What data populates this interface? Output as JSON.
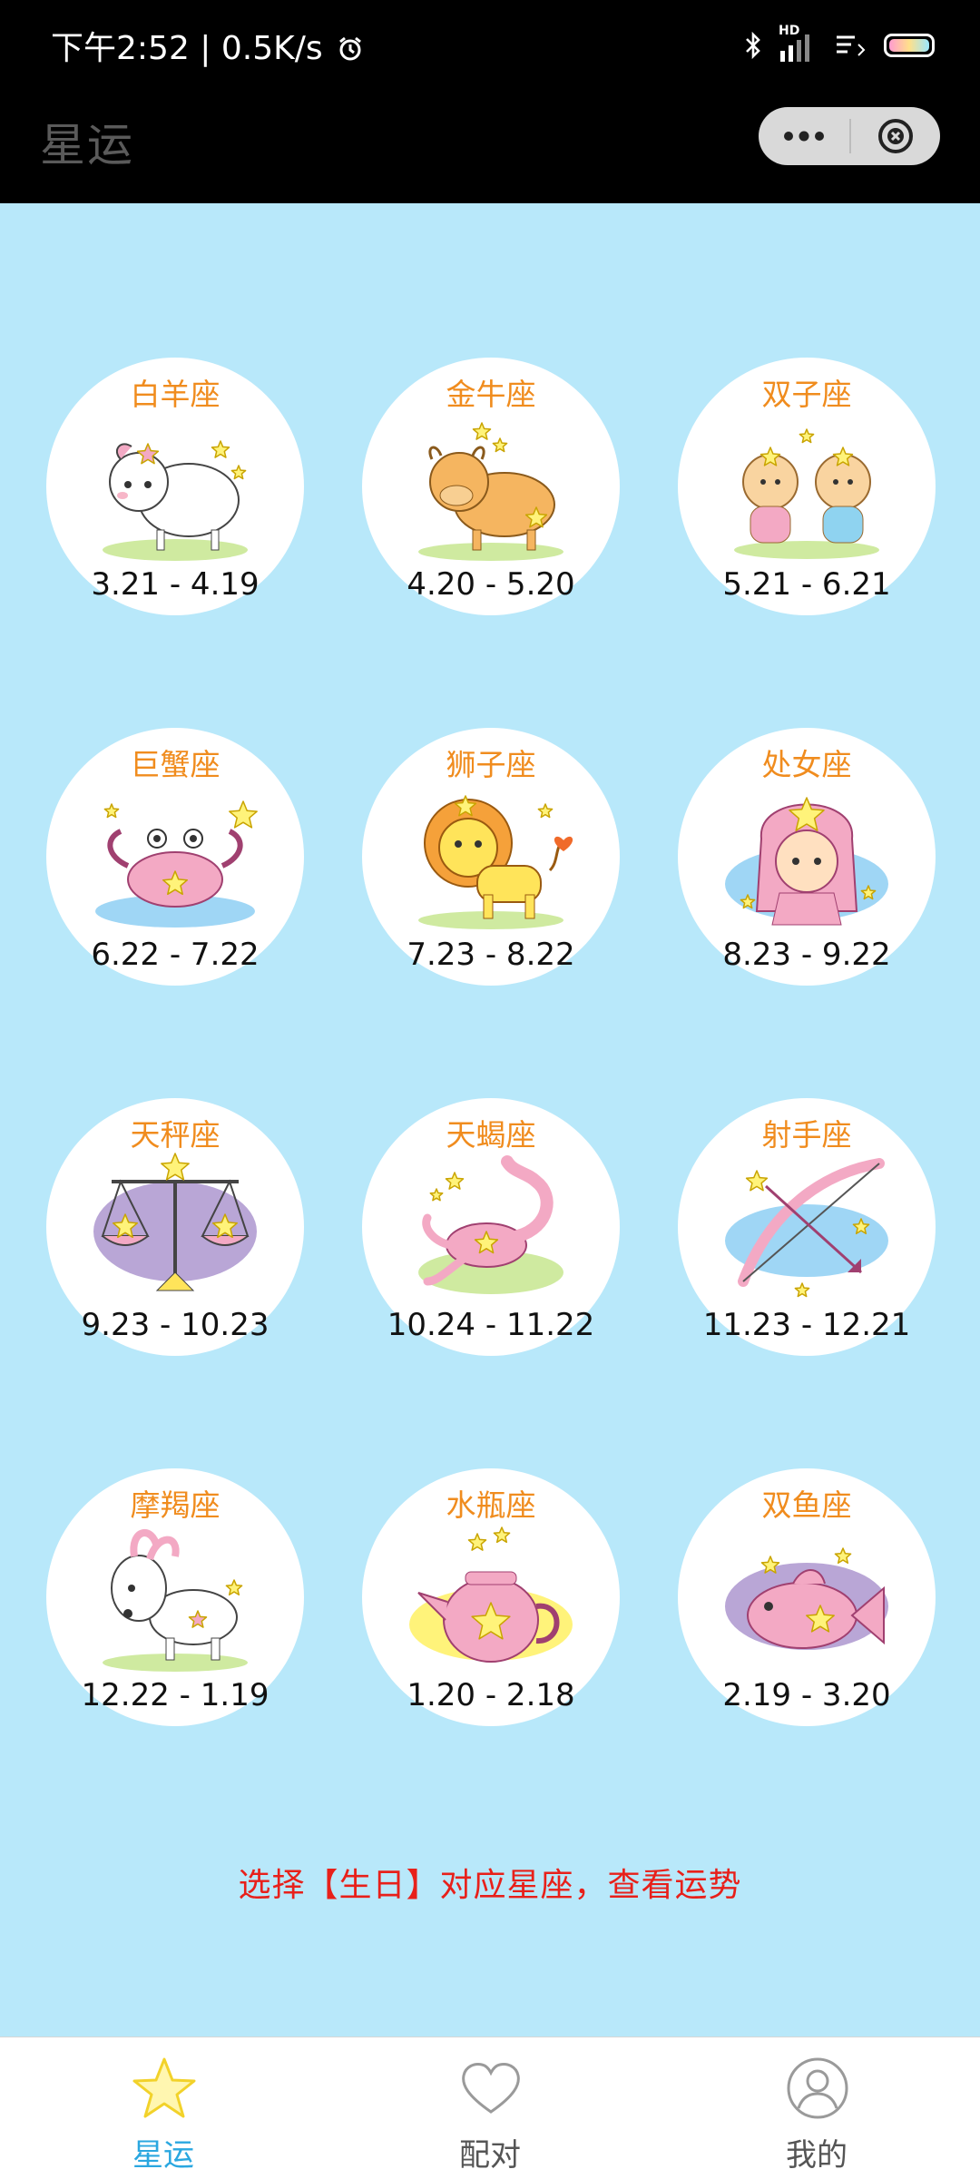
{
  "status": {
    "time_speed": "下午2:52 | 0.5K/s",
    "alarm_icon": "alarm-clock-icon",
    "bluetooth_icon": "bluetooth-icon",
    "signal_label": "HD",
    "battery_icon": "battery-icon"
  },
  "header": {
    "title": "星运",
    "more_icon": "more-dots-icon",
    "close_icon": "close-circle-icon"
  },
  "signs": [
    {
      "name": "白羊座",
      "date": "3.21 - 4.19",
      "art": "ram"
    },
    {
      "name": "金牛座",
      "date": "4.20 - 5.20",
      "art": "bull"
    },
    {
      "name": "双子座",
      "date": "5.21 - 6.21",
      "art": "twins"
    },
    {
      "name": "巨蟹座",
      "date": "6.22 - 7.22",
      "art": "crab"
    },
    {
      "name": "狮子座",
      "date": "7.23 - 8.22",
      "art": "lion"
    },
    {
      "name": "处女座",
      "date": "8.23 - 9.22",
      "art": "girl"
    },
    {
      "name": "天秤座",
      "date": "9.23 - 10.23",
      "art": "scales"
    },
    {
      "name": "天蝎座",
      "date": "10.24 - 11.22",
      "art": "scorpion"
    },
    {
      "name": "射手座",
      "date": "11.23 - 12.21",
      "art": "bow"
    },
    {
      "name": "摩羯座",
      "date": "12.22 - 1.19",
      "art": "goat"
    },
    {
      "name": "水瓶座",
      "date": "1.20 - 2.18",
      "art": "jug"
    },
    {
      "name": "双鱼座",
      "date": "2.19 - 3.20",
      "art": "fish"
    }
  ],
  "tip": "选择【生日】对应星座，查看运势",
  "tabs": [
    {
      "label": "星运",
      "icon": "star-icon",
      "active": true
    },
    {
      "label": "配对",
      "icon": "heart-icon",
      "active": false
    },
    {
      "label": "我的",
      "icon": "user-icon",
      "active": false
    }
  ],
  "colors": {
    "background": "#b8e8fa",
    "sign_name": "#f08c1e",
    "tip": "#e8201a",
    "tab_active": "#2aa7e0",
    "tab_inactive": "#555555"
  }
}
